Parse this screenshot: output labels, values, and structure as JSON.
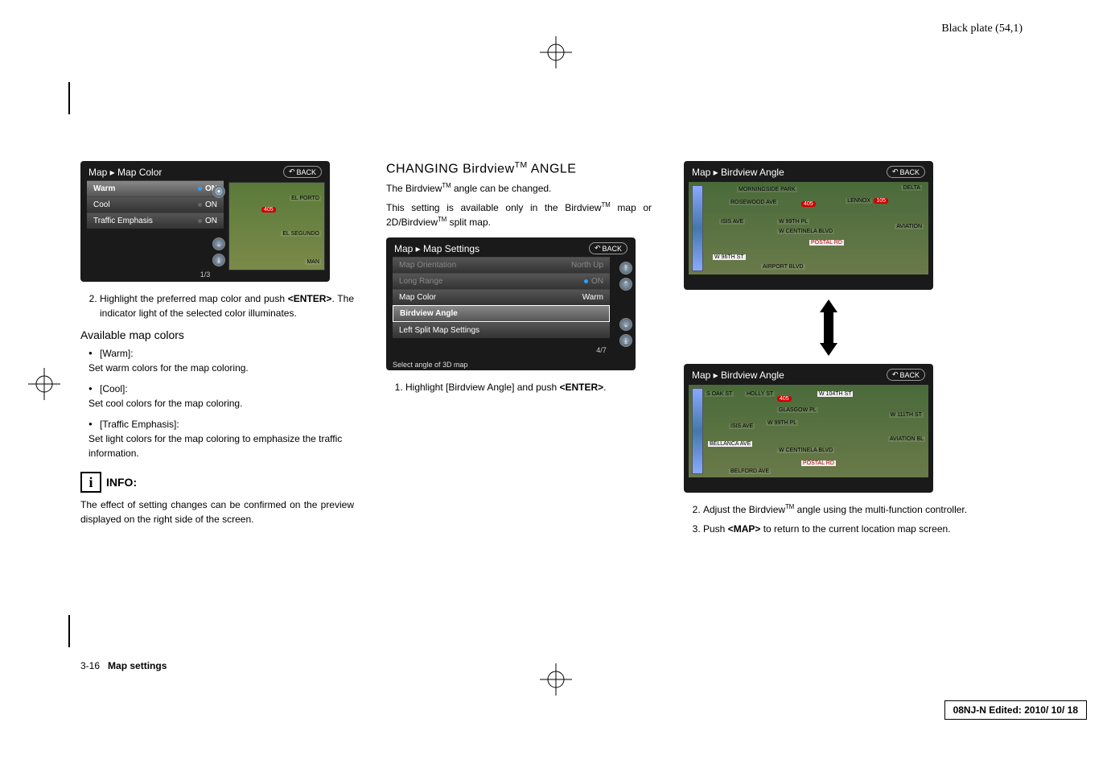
{
  "header": {
    "plate": "Black plate (54,1)"
  },
  "col1": {
    "ss1": {
      "breadcrumb": "Map ▸ Map Color",
      "back": "BACK",
      "rows": [
        {
          "label": "Warm",
          "value": "ON",
          "highlight": true
        },
        {
          "label": "Cool",
          "value": "ON"
        },
        {
          "label": "Traffic Emphasis",
          "value": "ON"
        }
      ],
      "preview_labels": [
        "EL PORTO",
        "EL SEGUNDO",
        "MAN"
      ],
      "counter": "1/3"
    },
    "step2": "Highlight the preferred map color and push <ENTER>. The indicator light of the selected color illuminates.",
    "subheading": "Available map colors",
    "bullets": [
      {
        "t": "[Warm]:",
        "d": "Set warm colors for the map coloring."
      },
      {
        "t": "[Cool]:",
        "d": "Set cool colors for the map coloring."
      },
      {
        "t": "[Traffic Emphasis]:",
        "d": "Set light colors for the map coloring to emphasize the traffic information."
      }
    ],
    "info_label": "INFO:",
    "info_text": "The effect of setting changes can be confirmed on the preview displayed on the right side of the screen."
  },
  "col2": {
    "heading": "CHANGING Birdview",
    "heading_suffix": " ANGLE",
    "p1_a": "The Birdview",
    "p1_b": " angle can be changed.",
    "p2_a": "This setting is available only in the Birdview",
    "p2_b": " map or 2D/Birdview",
    "p2_c": " split map.",
    "ss2": {
      "breadcrumb": "Map ▸ Map Settings",
      "back": "BACK",
      "rows": [
        {
          "label": "Map Orientation",
          "value": "North Up",
          "dim": true
        },
        {
          "label": "Long Range",
          "value": "ON",
          "dim": true,
          "dot": true
        },
        {
          "label": "Map Color",
          "value": "Warm"
        },
        {
          "label": "Birdview Angle",
          "highlight": true
        },
        {
          "label": "Left Split Map Settings"
        }
      ],
      "counter": "4/7",
      "hint": "Select angle of 3D map"
    },
    "step1_a": "Highlight [Birdview Angle] and push ",
    "step1_b": "<ENTER>",
    "step1_c": "."
  },
  "col3": {
    "ss3": {
      "breadcrumb": "Map ▸ Birdview Angle",
      "back": "BACK",
      "streets": [
        "MORNINGSIDE PARK",
        "ROSEWOOD AVE",
        "ISIS AVE",
        "W CENTINELA BLVD",
        "POSTAL RD",
        "W 96TH ST",
        "AIRPORT BLVD",
        "DELTA",
        "LENNOX",
        "AVIATION",
        "W 99TH PL"
      ]
    },
    "ss4": {
      "breadcrumb": "Map ▸ Birdview Angle",
      "back": "BACK",
      "streets": [
        "S OAK ST",
        "HOLLY ST",
        "W 104TH ST",
        "GLASGOW PL",
        "ISIS AVE",
        "BELLANCA AVE",
        "W CENTINELA BLVD",
        "POSTAL RD",
        "BELFORD AVE",
        "W 111TH ST",
        "AVIATION BL",
        "W 99TH PL"
      ]
    },
    "step2_a": "Adjust the Birdview",
    "step2_b": " angle using the multi-function controller.",
    "step3_a": "Push ",
    "step3_b": "<MAP>",
    "step3_c": " to return to the current location map screen."
  },
  "footer": {
    "left_page": "3-16",
    "left_title": "Map settings",
    "right": "08NJ-N Edited:  2010/ 10/ 18"
  }
}
